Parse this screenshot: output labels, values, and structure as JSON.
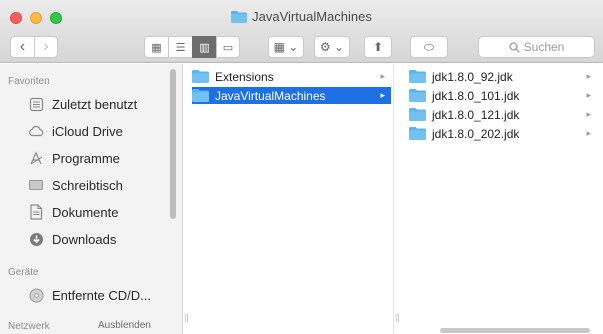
{
  "window": {
    "title": "JavaVirtualMachines",
    "accent": "#1f6fe5",
    "folder_color": "#5eb3ea"
  },
  "toolbar": {
    "back_glyph": "‹",
    "forward_glyph": "›",
    "view_icon": "▦",
    "view_list": "☰",
    "view_columns": "▥",
    "view_coverflow": "▭",
    "group_glyph": "▦ ⌄",
    "action_glyph": "⚙ ⌄",
    "share_glyph": "⬆",
    "tag_glyph": "⬭",
    "search_placeholder": "Suchen"
  },
  "sidebar": {
    "favorites_label": "Favoriten",
    "favorites": [
      {
        "label": "Zuletzt benutzt",
        "icon": "clock-icon"
      },
      {
        "label": "iCloud Drive",
        "icon": "cloud-icon"
      },
      {
        "label": "Programme",
        "icon": "applications-icon"
      },
      {
        "label": "Schreibtisch",
        "icon": "desktop-icon"
      },
      {
        "label": "Dokumente",
        "icon": "document-icon"
      },
      {
        "label": "Downloads",
        "icon": "download-icon"
      }
    ],
    "devices_label": "Geräte",
    "devices": [
      {
        "label": "Entfernte CD/D...",
        "icon": "disc-icon"
      }
    ],
    "network_label": "Netzwerk",
    "hide_label": "Ausblenden"
  },
  "columns": [
    {
      "items": [
        {
          "label": "Extensions",
          "selected": false
        },
        {
          "label": "JavaVirtualMachines",
          "selected": true
        }
      ]
    },
    {
      "items": [
        {
          "label": "jdk1.8.0_92.jdk",
          "selected": false
        },
        {
          "label": "jdk1.8.0_101.jdk",
          "selected": false
        },
        {
          "label": "jdk1.8.0_121.jdk",
          "selected": false
        },
        {
          "label": "jdk1.8.0_202.jdk",
          "selected": false
        }
      ]
    }
  ],
  "chevron_glyph": "▸"
}
